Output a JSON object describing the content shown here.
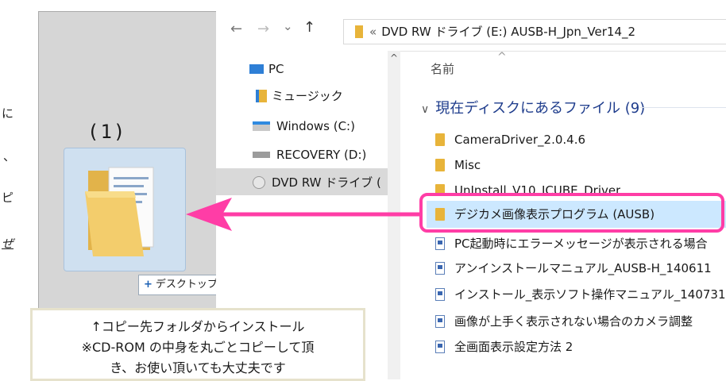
{
  "page_edge": {
    "t1": "に",
    "t2": "、",
    "t3": "ピ",
    "t4": "ぜ"
  },
  "desktop": {
    "step_label": "(1)",
    "copy_tooltip": {
      "icon": "plus-icon",
      "text": "デスクトップ へコピー"
    }
  },
  "explorer": {
    "nav": {
      "back": "←",
      "forward": "→",
      "down": "⌄",
      "up": "↑"
    },
    "address": {
      "prefix": "«",
      "path": "DVD RW ドライブ (E:) AUSB-H_Jpn_Ver14_2"
    },
    "navpane": {
      "items": [
        {
          "label": "PC",
          "icon": "pc-icon"
        },
        {
          "label": "ミュージック",
          "icon": "music-folder-icon"
        },
        {
          "label": "Windows (C:)",
          "icon": "windows-drive-icon"
        },
        {
          "label": "RECOVERY (D:)",
          "icon": "drive-icon"
        },
        {
          "label": "DVD RW ドライブ (",
          "icon": "dvd-drive-icon"
        }
      ]
    },
    "filepane": {
      "column_header": "名前",
      "group_header": "現在ディスクにあるファイル (9)",
      "files": [
        {
          "name": "CameraDriver_2.0.4.6",
          "type": "folder"
        },
        {
          "name": "Misc",
          "type": "folder"
        },
        {
          "name": "UnInstall_V10_ICUBE_Driver",
          "type": "folder"
        },
        {
          "name": "デジカメ画像表示プログラム (AUSB)",
          "type": "folder"
        },
        {
          "name": "PC起動時にエラーメッセージが表示される場合",
          "type": "pdf"
        },
        {
          "name": "アンインストールマニュアル_AUSB-H_140611",
          "type": "pdf"
        },
        {
          "name": "インストール_表示ソフト操作マニュアル_140731",
          "type": "pdf"
        },
        {
          "name": "画像が上手く表示されない場合のカメラ調整",
          "type": "pdf"
        },
        {
          "name": "全画面表示設定方法 2",
          "type": "pdf"
        }
      ]
    }
  },
  "note": {
    "line1": "↑コピー先フォルダからインストール",
    "line2": "※CD-ROM の中身を丸ごとコピーして頂",
    "line3": "き、お使い頂いても大丈夫です"
  },
  "colors": {
    "highlight": "#ff3da6",
    "selection": "#cce8ff",
    "folder": "#e8b43a"
  }
}
